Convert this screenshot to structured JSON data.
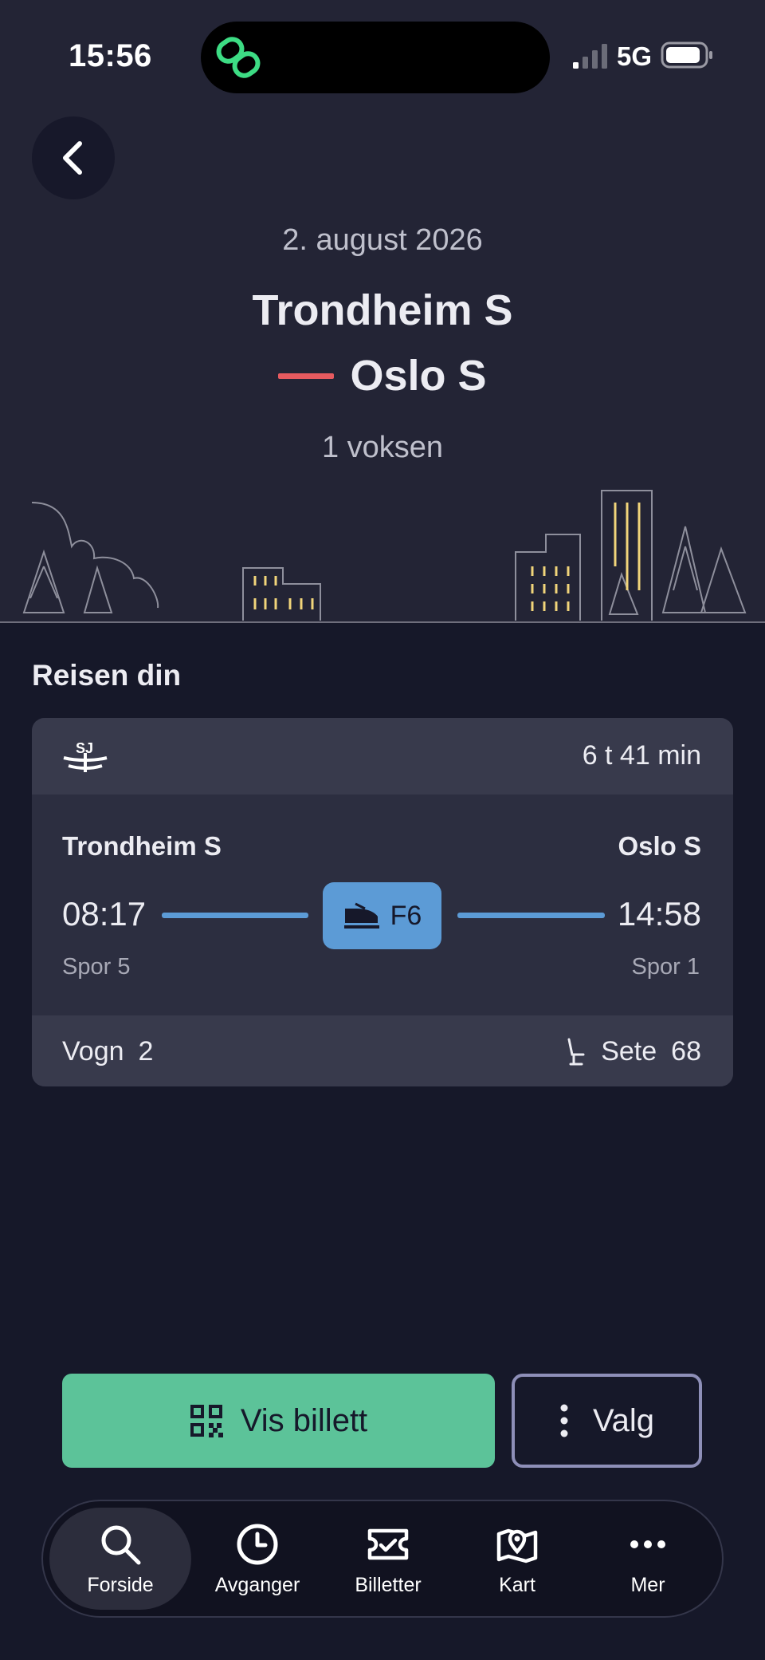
{
  "status_bar": {
    "time": "15:56",
    "network": "5G"
  },
  "journey": {
    "date": "2. august 2026",
    "from": "Trondheim S",
    "to": "Oslo S",
    "passengers": "1 voksen"
  },
  "section_title": "Reisen din",
  "trip": {
    "duration": "6 t 41 min",
    "from_station": "Trondheim S",
    "to_station": "Oslo S",
    "departure_time": "08:17",
    "arrival_time": "14:58",
    "train_line": "F6",
    "departure_track": "Spor 5",
    "arrival_track": "Spor 1",
    "car_label": "Vogn",
    "car_number": "2",
    "seat_label": "Sete",
    "seat_number": "68"
  },
  "actions": {
    "show_ticket": "Vis billett",
    "options": "Valg"
  },
  "tabs": [
    {
      "label": "Forside",
      "icon": "search-icon"
    },
    {
      "label": "Avganger",
      "icon": "clock-icon"
    },
    {
      "label": "Billetter",
      "icon": "ticket-icon"
    },
    {
      "label": "Kart",
      "icon": "map-pin-icon"
    },
    {
      "label": "Mer",
      "icon": "more-icon"
    }
  ],
  "colors": {
    "accent_green": "#5CC399",
    "train_blue": "#5C9BD6",
    "route_red": "#E65A5F",
    "background": "#161829"
  }
}
